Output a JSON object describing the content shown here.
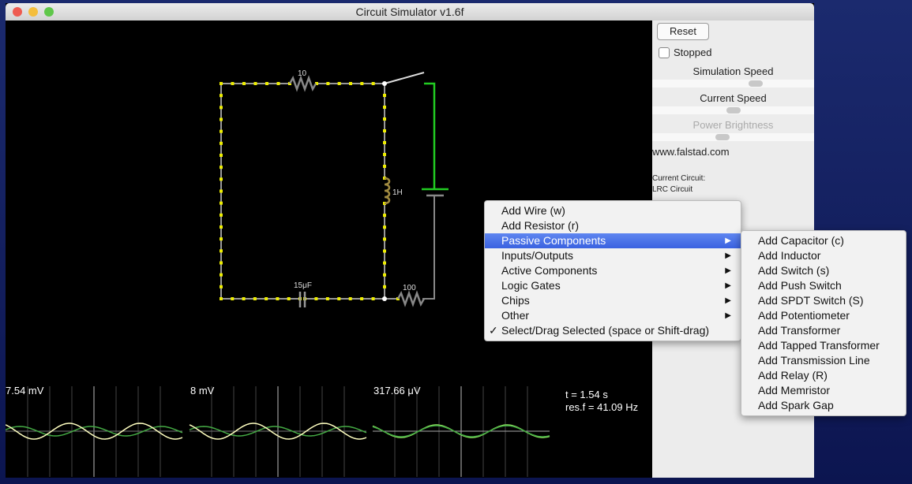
{
  "window": {
    "title": "Circuit Simulator v1.6f"
  },
  "panel": {
    "reset": "Reset",
    "stopped": "Stopped",
    "stopped_checked": false,
    "sim_speed": "Simulation Speed",
    "sim_speed_value": 0.65,
    "current_speed": "Current Speed",
    "current_speed_value": 0.5,
    "power_brightness": "Power Brightness",
    "power_brightness_value": 0.43,
    "link": "www.falstad.com",
    "current_circuit_label": "Current Circuit:",
    "current_circuit": "LRC Circuit"
  },
  "circuit": {
    "r1": "10",
    "inductor": "1H",
    "capacitor": "15μF",
    "r2": "100"
  },
  "scopes": [
    {
      "label": "7.54 mV"
    },
    {
      "label": "8 mV"
    },
    {
      "label": "317.66 μV"
    }
  ],
  "status": {
    "time": "t = 1.54 s",
    "resf": "res.f = 41.09 Hz"
  },
  "menu": {
    "items": [
      {
        "label": "Add Wire (w)"
      },
      {
        "label": "Add Resistor (r)"
      },
      {
        "label": "Passive Components",
        "sub": true,
        "selected": true
      },
      {
        "label": "Inputs/Outputs",
        "sub": true
      },
      {
        "label": "Active Components",
        "sub": true
      },
      {
        "label": "Logic Gates",
        "sub": true
      },
      {
        "label": "Chips",
        "sub": true
      },
      {
        "label": "Other",
        "sub": true
      },
      {
        "label": "Select/Drag Selected (space or Shift-drag)",
        "checked": true
      }
    ]
  },
  "submenu": {
    "items": [
      "Add Capacitor (c)",
      "Add Inductor",
      "Add Switch (s)",
      "Add Push Switch",
      "Add SPDT Switch (S)",
      "Add Potentiometer",
      "Add Transformer",
      "Add Tapped Transformer",
      "Add Transmission Line",
      "Add Relay (R)",
      "Add Memristor",
      "Add Spark Gap"
    ]
  }
}
